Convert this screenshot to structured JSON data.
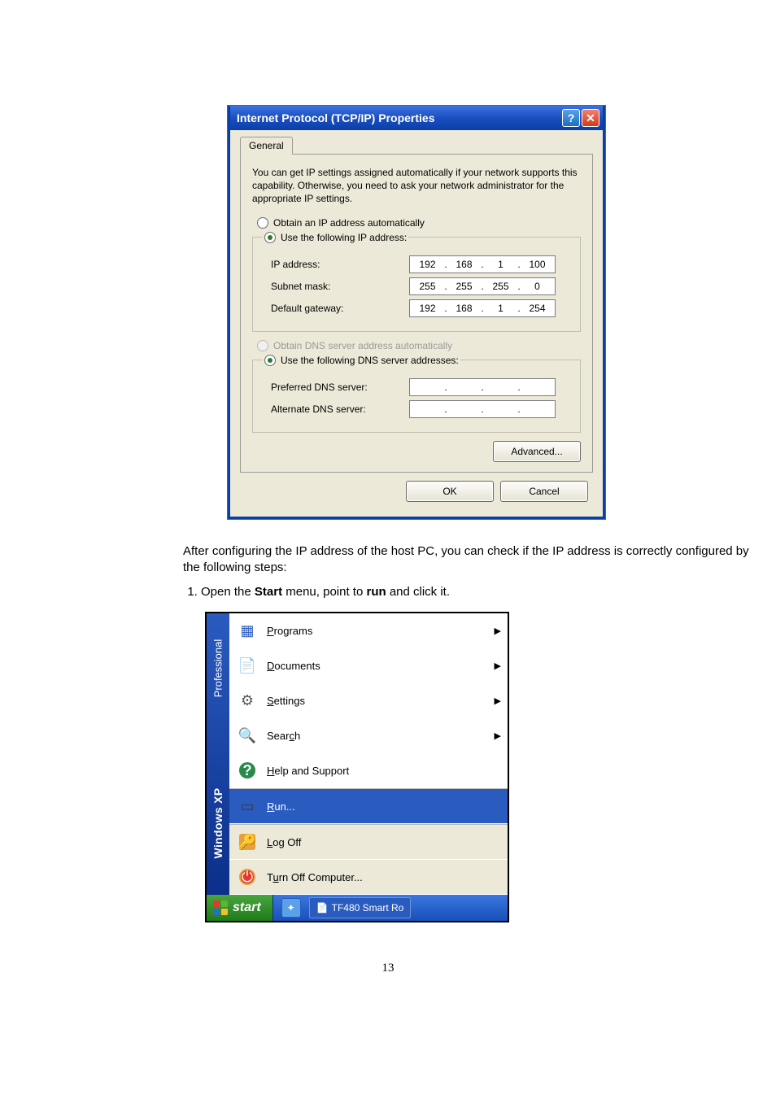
{
  "dialog": {
    "title": "Internet Protocol (TCP/IP) Properties",
    "tab": "General",
    "description": "You can get IP settings assigned automatically if your network supports this capability. Otherwise, you need to ask your network administrator for the appropriate IP settings.",
    "radio_ip_auto": "Obtain an IP address automatically",
    "radio_ip_manual": "Use the following IP address:",
    "ip_label": "IP address:",
    "subnet_label": "Subnet mask:",
    "gateway_label": "Default gateway:",
    "ip_value": {
      "a": "192",
      "b": "168",
      "c": "1",
      "d": "100"
    },
    "subnet_value": {
      "a": "255",
      "b": "255",
      "c": "255",
      "d": "0"
    },
    "gateway_value": {
      "a": "192",
      "b": "168",
      "c": "1",
      "d": "254"
    },
    "radio_dns_auto": "Obtain DNS server address automatically",
    "radio_dns_manual": "Use the following DNS server addresses:",
    "pref_dns_label": "Preferred DNS server:",
    "alt_dns_label": "Alternate DNS server:",
    "advanced_btn": "Advanced...",
    "ok_btn": "OK",
    "cancel_btn": "Cancel"
  },
  "body": {
    "para1": "After configuring the IP address of the host PC, you can check if the IP address is correctly configured by the following steps:",
    "step1_pre": "Open the ",
    "step1_b1": "Start",
    "step1_mid": " menu, point to ",
    "step1_b2": "run",
    "step1_post": " and click it."
  },
  "startmenu": {
    "brand_line1": "Windows XP",
    "brand_line2": "Professional",
    "items": {
      "programs": "Programs",
      "documents": "Documents",
      "settings": "Settings",
      "search": "Search",
      "help": "Help and Support",
      "run": "Run...",
      "logoff": "Log Off",
      "turnoff": "Turn Off Computer..."
    },
    "start_btn": "start",
    "task_item": "TF480 Smart Ro"
  },
  "page_number": "13"
}
